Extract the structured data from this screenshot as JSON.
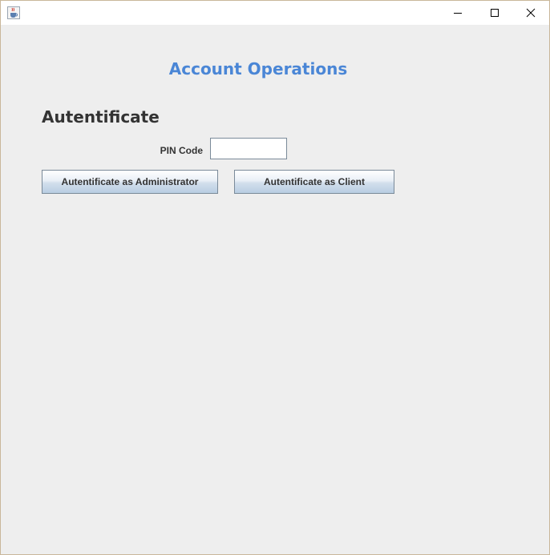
{
  "window": {
    "icon": "java-cup-icon",
    "controls": [
      "minimize-icon",
      "maximize-icon",
      "close-icon"
    ]
  },
  "main": {
    "title": "Account Operations",
    "section_title": "Autentificate",
    "pin": {
      "label": "PIN Code",
      "value": ""
    },
    "buttons": {
      "admin_label": "Autentificate as Administrator",
      "client_label": "Autentificate as Client"
    }
  },
  "colors": {
    "title_accent": "#4a86d6",
    "background": "#eeeeee"
  }
}
